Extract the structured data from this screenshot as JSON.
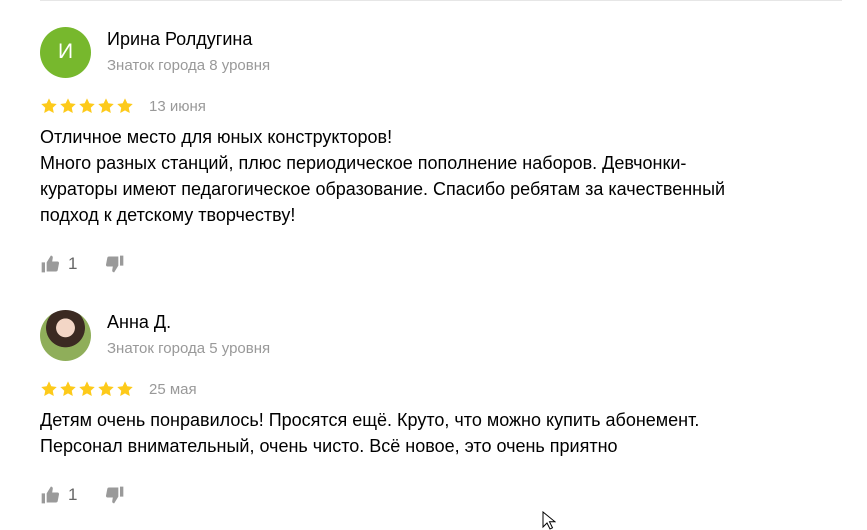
{
  "colors": {
    "star": "#fdca1a",
    "avatar_green": "#77b82d",
    "muted_text": "#999999",
    "icon_gray": "#9a9a9a"
  },
  "reviews": [
    {
      "avatar_letter": "И",
      "avatar_type": "letter",
      "name": "Ирина Ролдугина",
      "level": "Знаток города 8 уровня",
      "stars": 5,
      "date": "13 июня",
      "text": "Отличное место для юных конструкторов!\nМного разных станций, плюс периодическое пополнение наборов. Девчонки-\nкураторы имеют педагогическое образование. Спасибо ребятам за качественный\nподход к детскому творчеству!",
      "likes": "1",
      "like_icon": "thumbs-up-icon",
      "dislike_icon": "thumbs-down-icon"
    },
    {
      "avatar_letter": "",
      "avatar_type": "photo",
      "name": "Анна Д.",
      "level": "Знаток города 5 уровня",
      "stars": 5,
      "date": "25 мая",
      "text": "Детям очень понравилось! Просятся ещё. Круто, что можно купить абонемент.\nПерсонал внимательный, очень чисто. Всё новое, это очень приятно",
      "likes": "1",
      "like_icon": "thumbs-up-icon",
      "dislike_icon": "thumbs-down-icon"
    }
  ]
}
